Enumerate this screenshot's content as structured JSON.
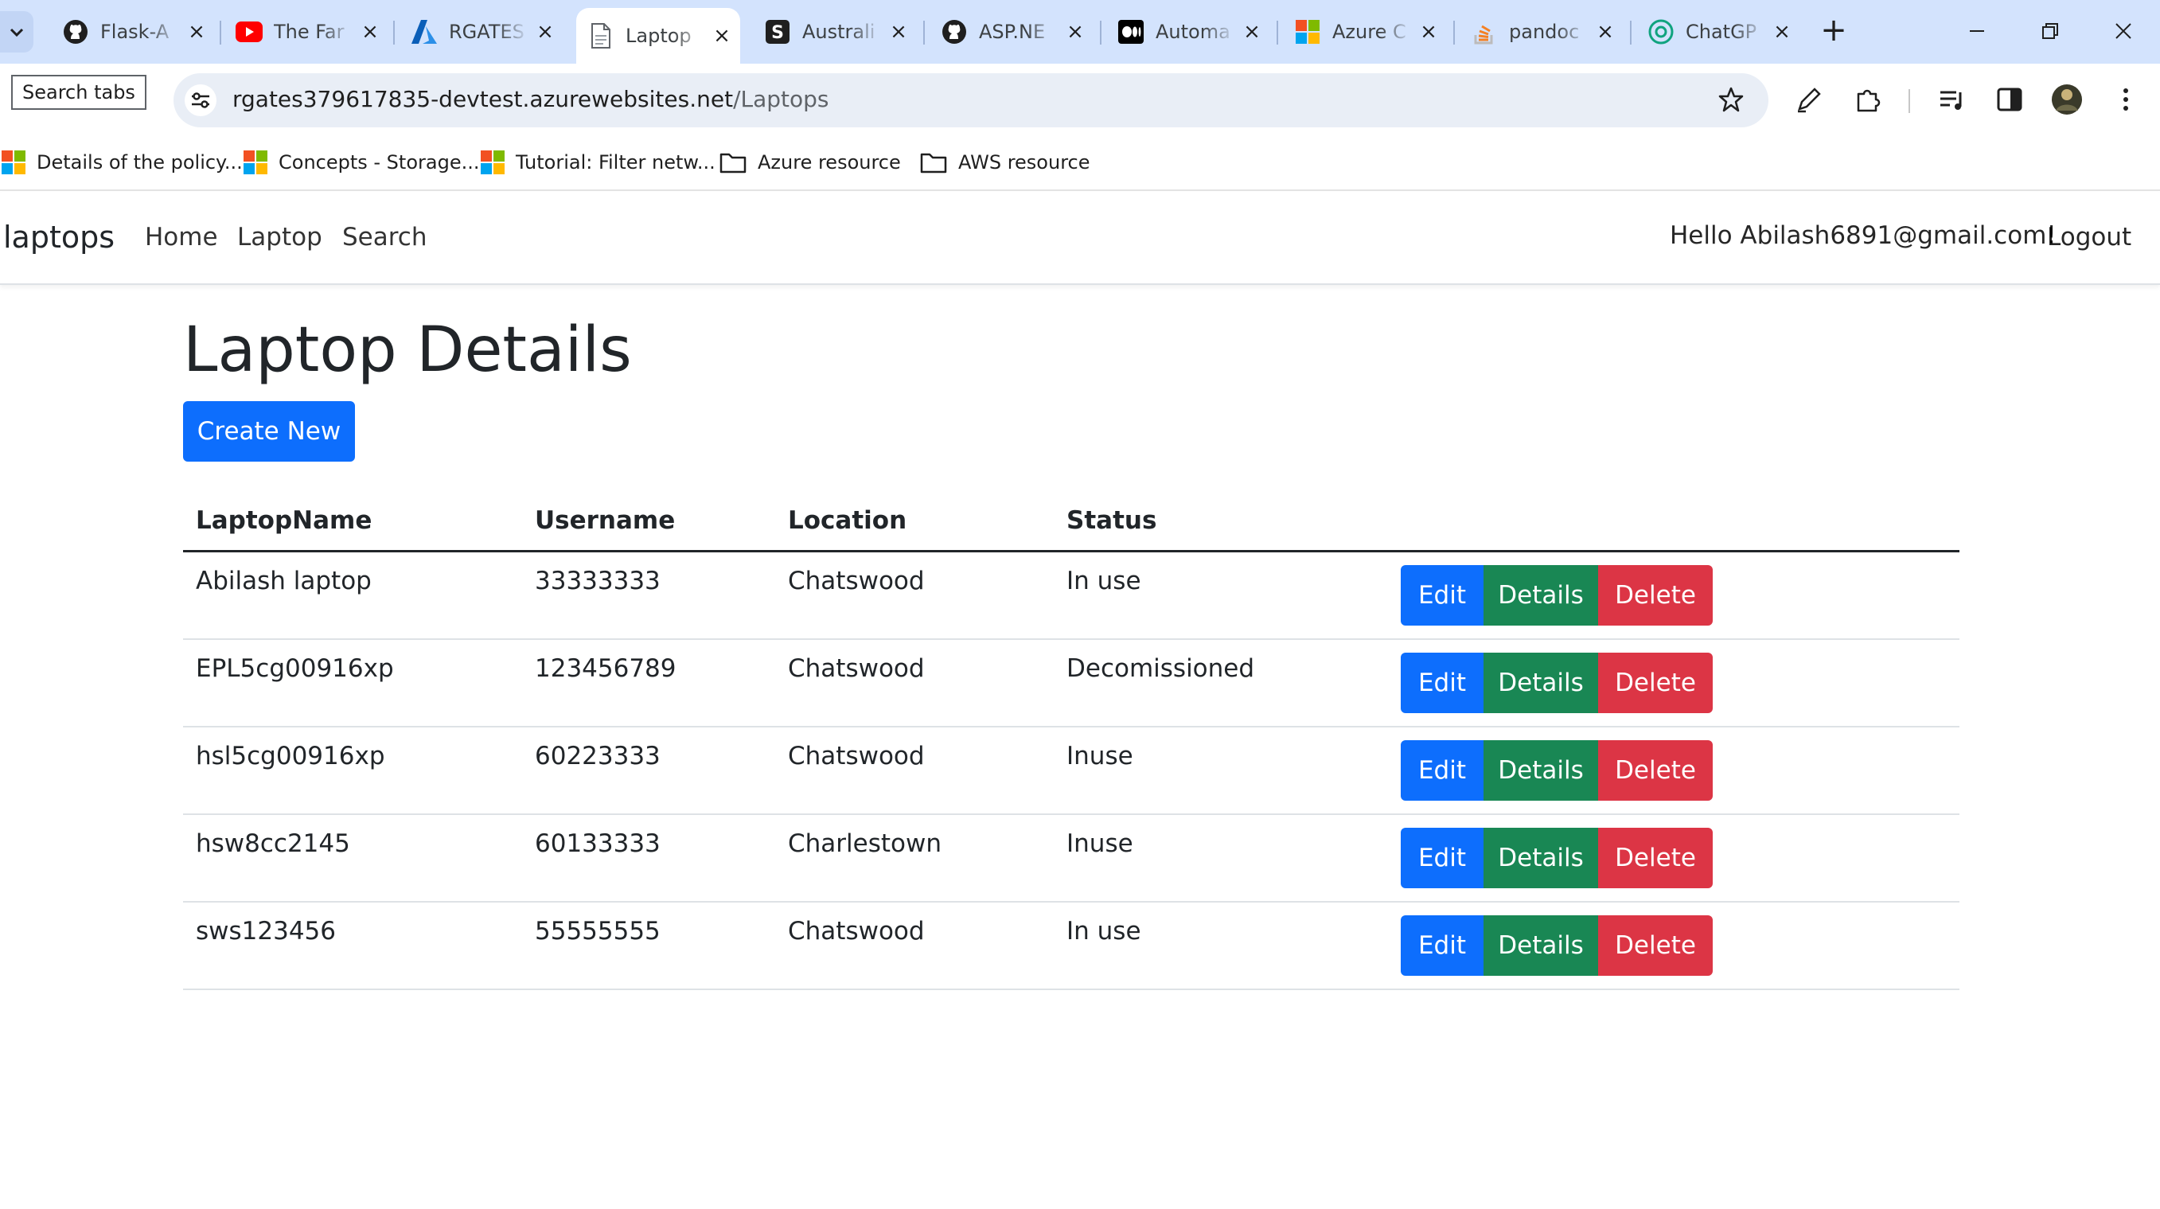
{
  "browser": {
    "tabs": [
      {
        "title": "Flask-A",
        "icon": "github-icon",
        "active": false
      },
      {
        "title": "The Far",
        "icon": "youtube-icon",
        "active": false
      },
      {
        "title": "RGATES",
        "icon": "azure-icon",
        "active": false
      },
      {
        "title": "Laptop",
        "icon": "page-icon",
        "active": true
      },
      {
        "title": "Australi",
        "icon": "s-app-icon",
        "active": false
      },
      {
        "title": "ASP.NE",
        "icon": "github-icon",
        "active": false
      },
      {
        "title": "Automa",
        "icon": "medium-icon",
        "active": false
      },
      {
        "title": "Azure C",
        "icon": "microsoft-icon",
        "active": false
      },
      {
        "title": "pandoc",
        "icon": "stackoverflow-icon",
        "active": false
      },
      {
        "title": "ChatGP",
        "icon": "chatgpt-icon",
        "active": false
      }
    ],
    "tooltip": "Search tabs",
    "url": {
      "host": "rgates379617835-devtest.azurewebsites.net",
      "path": "/Laptops"
    },
    "bookmarks": [
      {
        "label": "Details of the policy...",
        "icon": "microsoft-icon"
      },
      {
        "label": "Concepts - Storage...",
        "icon": "microsoft-icon"
      },
      {
        "label": "Tutorial: Filter netw...",
        "icon": "microsoft-icon"
      },
      {
        "label": "Azure resource",
        "icon": "folder-icon"
      },
      {
        "label": "AWS resource",
        "icon": "folder-icon"
      }
    ]
  },
  "navbar": {
    "brand": "laptops",
    "links": [
      "Home",
      "Laptop",
      "Search"
    ],
    "greeting": "Hello Abilash6891@gmail.com!",
    "logout": "Logout"
  },
  "main": {
    "title": "Laptop Details",
    "create_label": "Create New",
    "columns": [
      "LaptopName",
      "Username",
      "Location",
      "Status"
    ],
    "rows": [
      {
        "name": "Abilash laptop",
        "username": "33333333",
        "location": "Chatswood",
        "status": "In use"
      },
      {
        "name": "EPL5cg00916xp",
        "username": "123456789",
        "location": "Chatswood",
        "status": "Decomissioned"
      },
      {
        "name": "hsl5cg00916xp",
        "username": "60223333",
        "location": "Chatswood",
        "status": "Inuse"
      },
      {
        "name": "hsw8cc2145",
        "username": "60133333",
        "location": "Charlestown",
        "status": "Inuse"
      },
      {
        "name": "sws123456",
        "username": "55555555",
        "location": "Chatswood",
        "status": "In use"
      }
    ],
    "actions": {
      "edit": "Edit",
      "details": "Details",
      "delete": "Delete"
    }
  },
  "colors": {
    "primary": "#0d6efd",
    "success": "#198754",
    "danger": "#dc3545",
    "tabstrip": "#d3e3fd"
  }
}
